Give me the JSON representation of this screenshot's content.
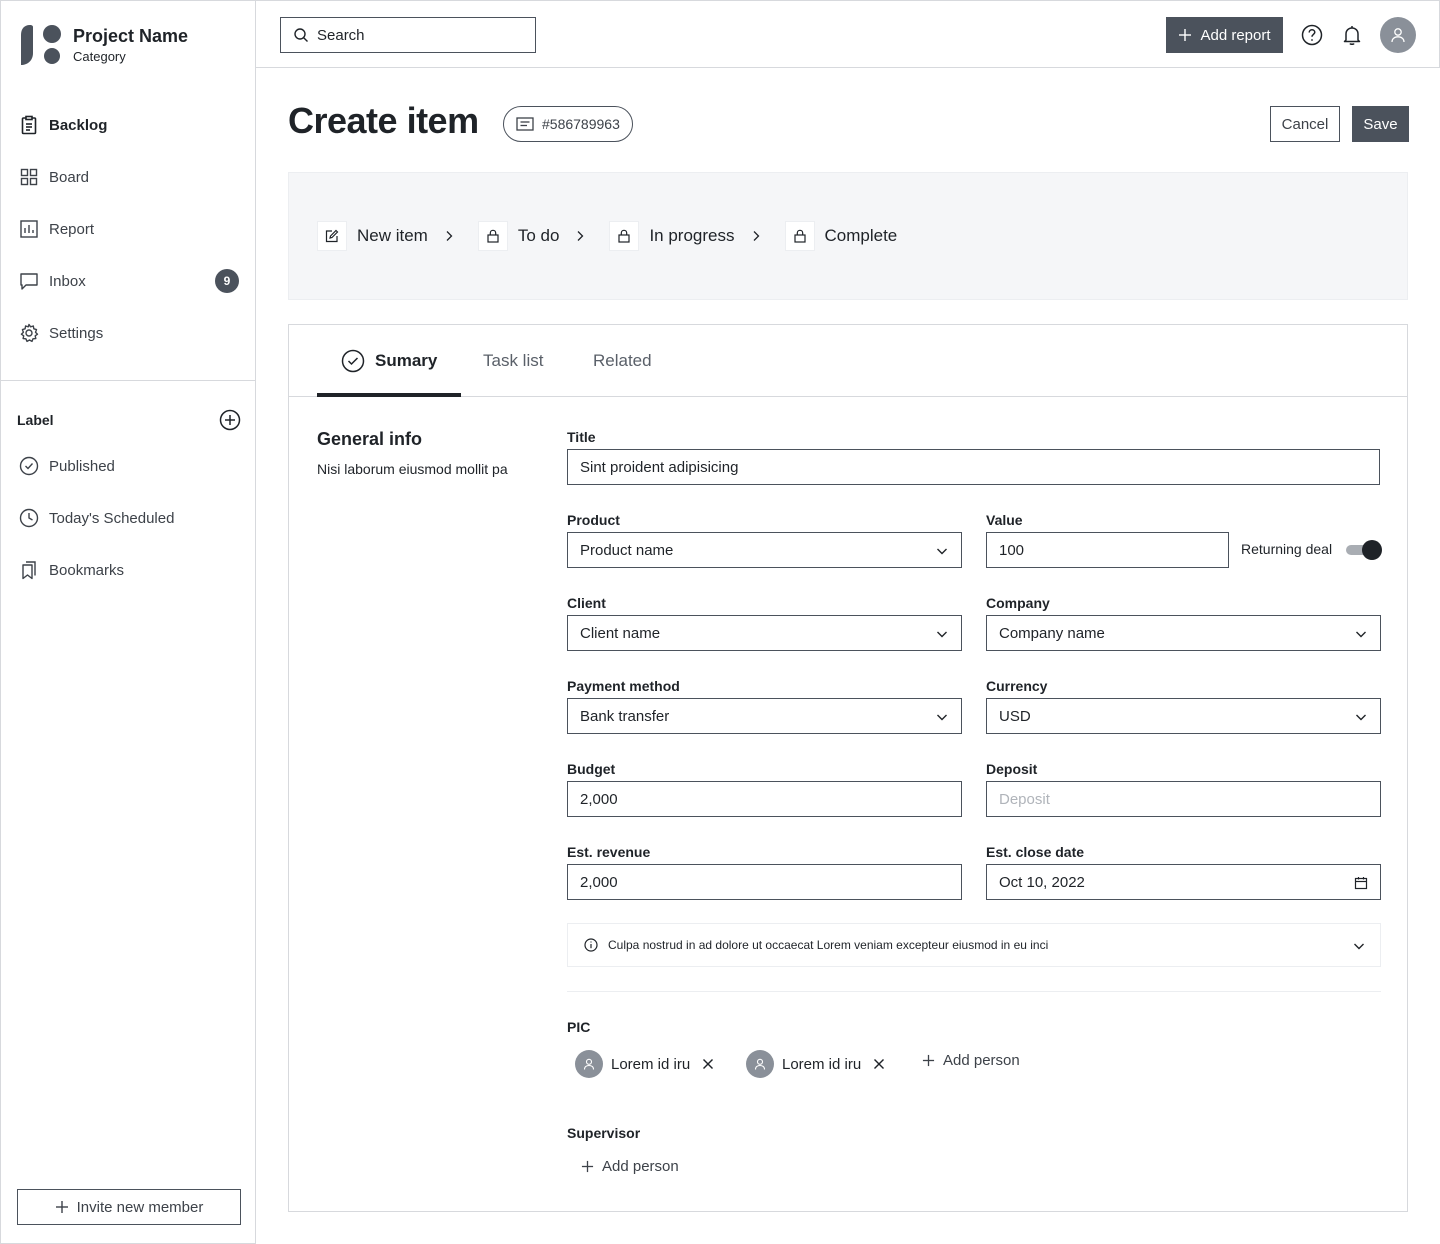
{
  "brand": {
    "name": "Project Name",
    "category": "Category"
  },
  "nav": [
    {
      "label": "Backlog",
      "icon": "clipboard-icon",
      "active": true
    },
    {
      "label": "Board",
      "icon": "grid-icon"
    },
    {
      "label": "Report",
      "icon": "chart-icon"
    },
    {
      "label": "Inbox",
      "icon": "chat-icon",
      "badge": "9"
    },
    {
      "label": "Settings",
      "icon": "gear-icon"
    }
  ],
  "labels": {
    "title": "Label",
    "items": [
      {
        "label": "Published",
        "icon": "check-circle-icon"
      },
      {
        "label": "Today's Scheduled",
        "icon": "clock-icon"
      },
      {
        "label": "Bookmarks",
        "icon": "bookmarks-icon"
      }
    ]
  },
  "invite_label": "Invite new member",
  "topbar": {
    "search_placeholder": "Search",
    "add_report_label": "Add report"
  },
  "page": {
    "title": "Create item",
    "item_id": "#586789963",
    "cancel_label": "Cancel",
    "save_label": "Save"
  },
  "steps": [
    {
      "label": "New item",
      "icon": "edit-icon"
    },
    {
      "label": "To do",
      "icon": "lock-icon"
    },
    {
      "label": "In progress",
      "icon": "lock-icon"
    },
    {
      "label": "Complete",
      "icon": "lock-icon"
    }
  ],
  "tabs": [
    {
      "label": "Sumary",
      "active": true
    },
    {
      "label": "Task list"
    },
    {
      "label": "Related"
    }
  ],
  "general": {
    "title": "General info",
    "description": "Nisi laborum eiusmod mollit pa"
  },
  "form": {
    "title": {
      "label": "Title",
      "value": "Sint proident adipisicing"
    },
    "product": {
      "label": "Product",
      "value": "Product name"
    },
    "value": {
      "label": "Value",
      "value": "100"
    },
    "returning_deal": {
      "label": "Returning deal",
      "on": true
    },
    "client": {
      "label": "Client",
      "value": "Client name"
    },
    "company": {
      "label": "Company",
      "value": "Company name"
    },
    "payment_method": {
      "label": "Payment method",
      "value": "Bank transfer"
    },
    "currency": {
      "label": "Currency",
      "value": "USD"
    },
    "budget": {
      "label": "Budget",
      "value": "2,000"
    },
    "deposit": {
      "label": "Deposit",
      "placeholder": "Deposit"
    },
    "est_revenue": {
      "label": "Est. revenue",
      "value": "2,000"
    },
    "est_close_date": {
      "label": "Est. close date",
      "value": "Oct 10, 2022"
    }
  },
  "info_text": "Culpa nostrud in ad dolore ut occaecat Lorem veniam excepteur eiusmod in eu inci",
  "pic": {
    "label": "PIC",
    "people": [
      "Lorem id iru",
      "Lorem id iru"
    ],
    "add_label": "Add person"
  },
  "supervisor": {
    "label": "Supervisor",
    "add_label": "Add person"
  },
  "colors": {
    "accent": "#4b525c",
    "badge": "#4b525c",
    "step_bg": "#f5f6f8"
  }
}
